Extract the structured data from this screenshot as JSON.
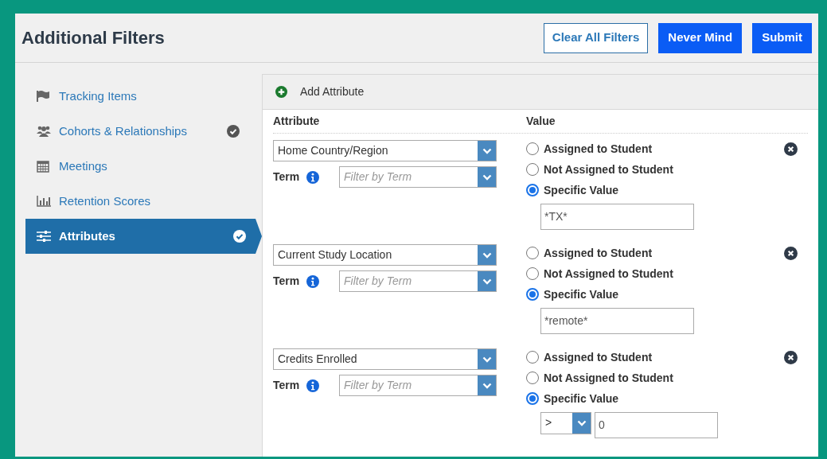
{
  "title": "Additional Filters",
  "buttons": [
    {
      "label": "Clear All Filters",
      "kind": "outline"
    },
    {
      "label": "Never Mind",
      "kind": "primary"
    },
    {
      "label": "Submit",
      "kind": "primary"
    }
  ],
  "sidebar": {
    "items": [
      {
        "label": "Tracking Items",
        "done": false,
        "selected": false
      },
      {
        "label": "Cohorts & Relationships",
        "done": true,
        "selected": false
      },
      {
        "label": "Meetings",
        "done": false,
        "selected": false
      },
      {
        "label": "Retention Scores",
        "done": false,
        "selected": false
      },
      {
        "label": "Attributes",
        "done": true,
        "selected": true
      }
    ]
  },
  "add_attribute": "Add Attribute",
  "columns": [
    "Attribute",
    "Value"
  ],
  "rows": [
    {
      "attribute": "Home Country/Region",
      "term_label": "Term",
      "term_placeholder": "Filter by Term",
      "options": [
        {
          "label": "Assigned to Student",
          "selected": false
        },
        {
          "label": "Not Assigned to Student",
          "selected": false
        },
        {
          "label": "Specific Value",
          "selected": true
        }
      ],
      "value": {
        "kind": "text",
        "text": "*TX*"
      }
    },
    {
      "attribute": "Current Study Location",
      "term_label": "Term",
      "term_placeholder": "Filter by Term",
      "options": [
        {
          "label": "Assigned to Student",
          "selected": false
        },
        {
          "label": "Not Assigned to Student",
          "selected": false
        },
        {
          "label": "Specific Value",
          "selected": true
        }
      ],
      "value": {
        "kind": "text",
        "text": "*remote*"
      }
    },
    {
      "attribute": "Credits Enrolled",
      "term_label": "Term",
      "term_placeholder": "Filter by Term",
      "options": [
        {
          "label": "Assigned to Student",
          "selected": false
        },
        {
          "label": "Not Assigned to Student",
          "selected": false
        },
        {
          "label": "Specific Value",
          "selected": true
        }
      ],
      "value": {
        "kind": "comparison",
        "operator": ">",
        "text": "0"
      }
    }
  ]
}
